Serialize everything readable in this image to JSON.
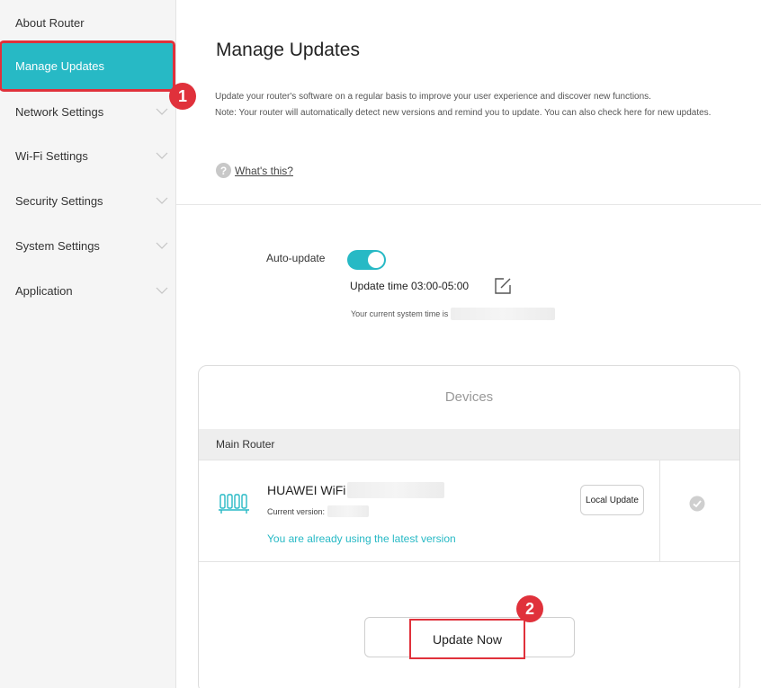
{
  "sidebar": {
    "items": [
      {
        "label": "About Router",
        "has_chevron": false
      },
      {
        "label": "Manage Updates",
        "has_chevron": false,
        "active": true
      },
      {
        "label": "Network Settings",
        "has_chevron": true
      },
      {
        "label": "Wi-Fi Settings",
        "has_chevron": true
      },
      {
        "label": "Security Settings",
        "has_chevron": true
      },
      {
        "label": "System Settings",
        "has_chevron": true
      },
      {
        "label": "Application",
        "has_chevron": true
      }
    ],
    "step_badge": "1"
  },
  "main": {
    "title": "Manage Updates",
    "description": "Update your router's software on a regular basis to improve your user experience and discover new functions.",
    "note": "Note: Your router will automatically detect new versions and remind you to update. You can also check here for new updates.",
    "whats_this": "What's this?",
    "auto_update_label": "Auto-update",
    "auto_update_enabled": true,
    "update_time": "Update time 03:00-05:00",
    "system_time_label": "Your current system time is"
  },
  "devices": {
    "title": "Devices",
    "section": "Main Router",
    "device_name": "HUAWEI WiFi",
    "current_version_label": "Current version:",
    "status": "You are already using the latest version",
    "local_update_label": "Local Update",
    "update_now_label": "Update Now",
    "step_badge": "2"
  },
  "colors": {
    "accent": "#27b9c5",
    "highlight": "#e0313b"
  },
  "icons": {
    "help": "question-circle-icon",
    "edit": "edit-icon",
    "router": "router-icon",
    "check": "check-circle-icon",
    "chevron": "chevron-down-icon"
  }
}
